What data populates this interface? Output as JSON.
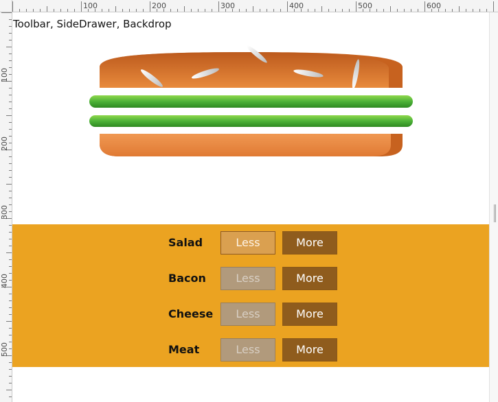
{
  "ruler": {
    "top_labels": [
      "100",
      "200",
      "300",
      "400",
      "500",
      "600"
    ],
    "left_labels": [
      "100",
      "200",
      "300",
      "400",
      "500"
    ]
  },
  "page": {
    "title": "Toolbar, SideDrawer, Backdrop"
  },
  "burger": {
    "layers": [
      "salad",
      "salad"
    ],
    "colors": {
      "bread": "#e37e35",
      "bread_dark": "#c15f1c",
      "salad": "#4bb233",
      "salad_dark": "#2f8b20",
      "seed": "#f4f4f4"
    }
  },
  "controls": {
    "background": "#eba321",
    "items": [
      {
        "label": "Salad",
        "less": "Less",
        "more": "More",
        "less_disabled": false
      },
      {
        "label": "Bacon",
        "less": "Less",
        "more": "More",
        "less_disabled": true
      },
      {
        "label": "Cheese",
        "less": "Less",
        "more": "More",
        "less_disabled": true
      },
      {
        "label": "Meat",
        "less": "Less",
        "more": "More",
        "less_disabled": true
      }
    ]
  }
}
